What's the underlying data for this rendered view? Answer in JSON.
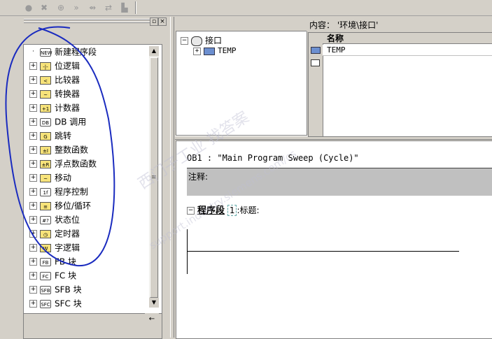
{
  "toolbar": {
    "buttons": [
      {
        "icon": "circle-icon",
        "glyph": "●"
      },
      {
        "icon": "cross-plug-icon",
        "glyph": "✖"
      },
      {
        "icon": "connect-icon",
        "glyph": "⊕"
      },
      {
        "icon": "forward-icon",
        "glyph": "»"
      },
      {
        "icon": "link-icon",
        "glyph": "⇴"
      },
      {
        "icon": "export-icon",
        "glyph": "⇄"
      },
      {
        "icon": "block-icon",
        "glyph": "▙"
      }
    ]
  },
  "left_panel": {
    "tree": [
      {
        "label": "新建程序段",
        "icon": "new-network-icon",
        "icon_text": "NEW",
        "expandable": false
      },
      {
        "label": "位逻辑",
        "icon": "bit-logic-icon",
        "icon_text": "-|-",
        "expandable": true
      },
      {
        "label": "比较器",
        "icon": "comparator-icon",
        "icon_text": "<",
        "expandable": true
      },
      {
        "label": "转换器",
        "icon": "converter-icon",
        "icon_text": "~",
        "expandable": true
      },
      {
        "label": "计数器",
        "icon": "counter-icon",
        "icon_text": "+1",
        "expandable": true
      },
      {
        "label": "DB 调用",
        "icon": "db-call-icon",
        "icon_text": "DB",
        "expandable": true
      },
      {
        "label": "跳转",
        "icon": "jump-icon",
        "icon_text": "G",
        "expandable": true
      },
      {
        "label": "整数函数",
        "icon": "integer-function-icon",
        "icon_text": "±I",
        "expandable": true
      },
      {
        "label": "浮点数函数",
        "icon": "float-function-icon",
        "icon_text": "±R",
        "expandable": true
      },
      {
        "label": "移动",
        "icon": "move-icon",
        "icon_text": "~",
        "expandable": true
      },
      {
        "label": "程序控制",
        "icon": "program-control-icon",
        "icon_text": "1f",
        "expandable": true
      },
      {
        "label": "移位/循环",
        "icon": "shift-rotate-icon",
        "icon_text": "≡",
        "expandable": true
      },
      {
        "label": "状态位",
        "icon": "status-bit-icon",
        "icon_text": "#?",
        "expandable": true
      },
      {
        "label": "定时器",
        "icon": "timer-icon",
        "icon_text": "◷",
        "expandable": true
      },
      {
        "label": "字逻辑",
        "icon": "word-logic-icon",
        "icon_text": "W",
        "expandable": true
      },
      {
        "label": "FB 块",
        "icon": "fb-block-icon",
        "icon_text": "FB",
        "expandable": true
      },
      {
        "label": "FC 块",
        "icon": "fc-block-icon",
        "icon_text": "FC",
        "expandable": true
      },
      {
        "label": "SFB 块",
        "icon": "sfb-block-icon",
        "icon_text": "SFB",
        "expandable": true
      },
      {
        "label": "SFC 块",
        "icon": "sfc-block-icon",
        "icon_text": "SFC",
        "expandable": true
      }
    ],
    "bottom_button": "←"
  },
  "interface": {
    "tree_root": "接口",
    "tree_child": "TEMP",
    "content_title": "内容：  '环境\\接口'",
    "table_header": "名称",
    "table_rows": [
      "TEMP"
    ]
  },
  "code": {
    "ob_title": "OB1 :  \"Main Program Sweep (Cycle)\"",
    "comment_label": "注释:",
    "network_label": "程序段",
    "network_number": "1",
    "network_suffix": ":标题:"
  },
  "watermark": {
    "line1": "西门子工业  找答案",
    "line2": "support.industry.siemens.com/cs"
  }
}
